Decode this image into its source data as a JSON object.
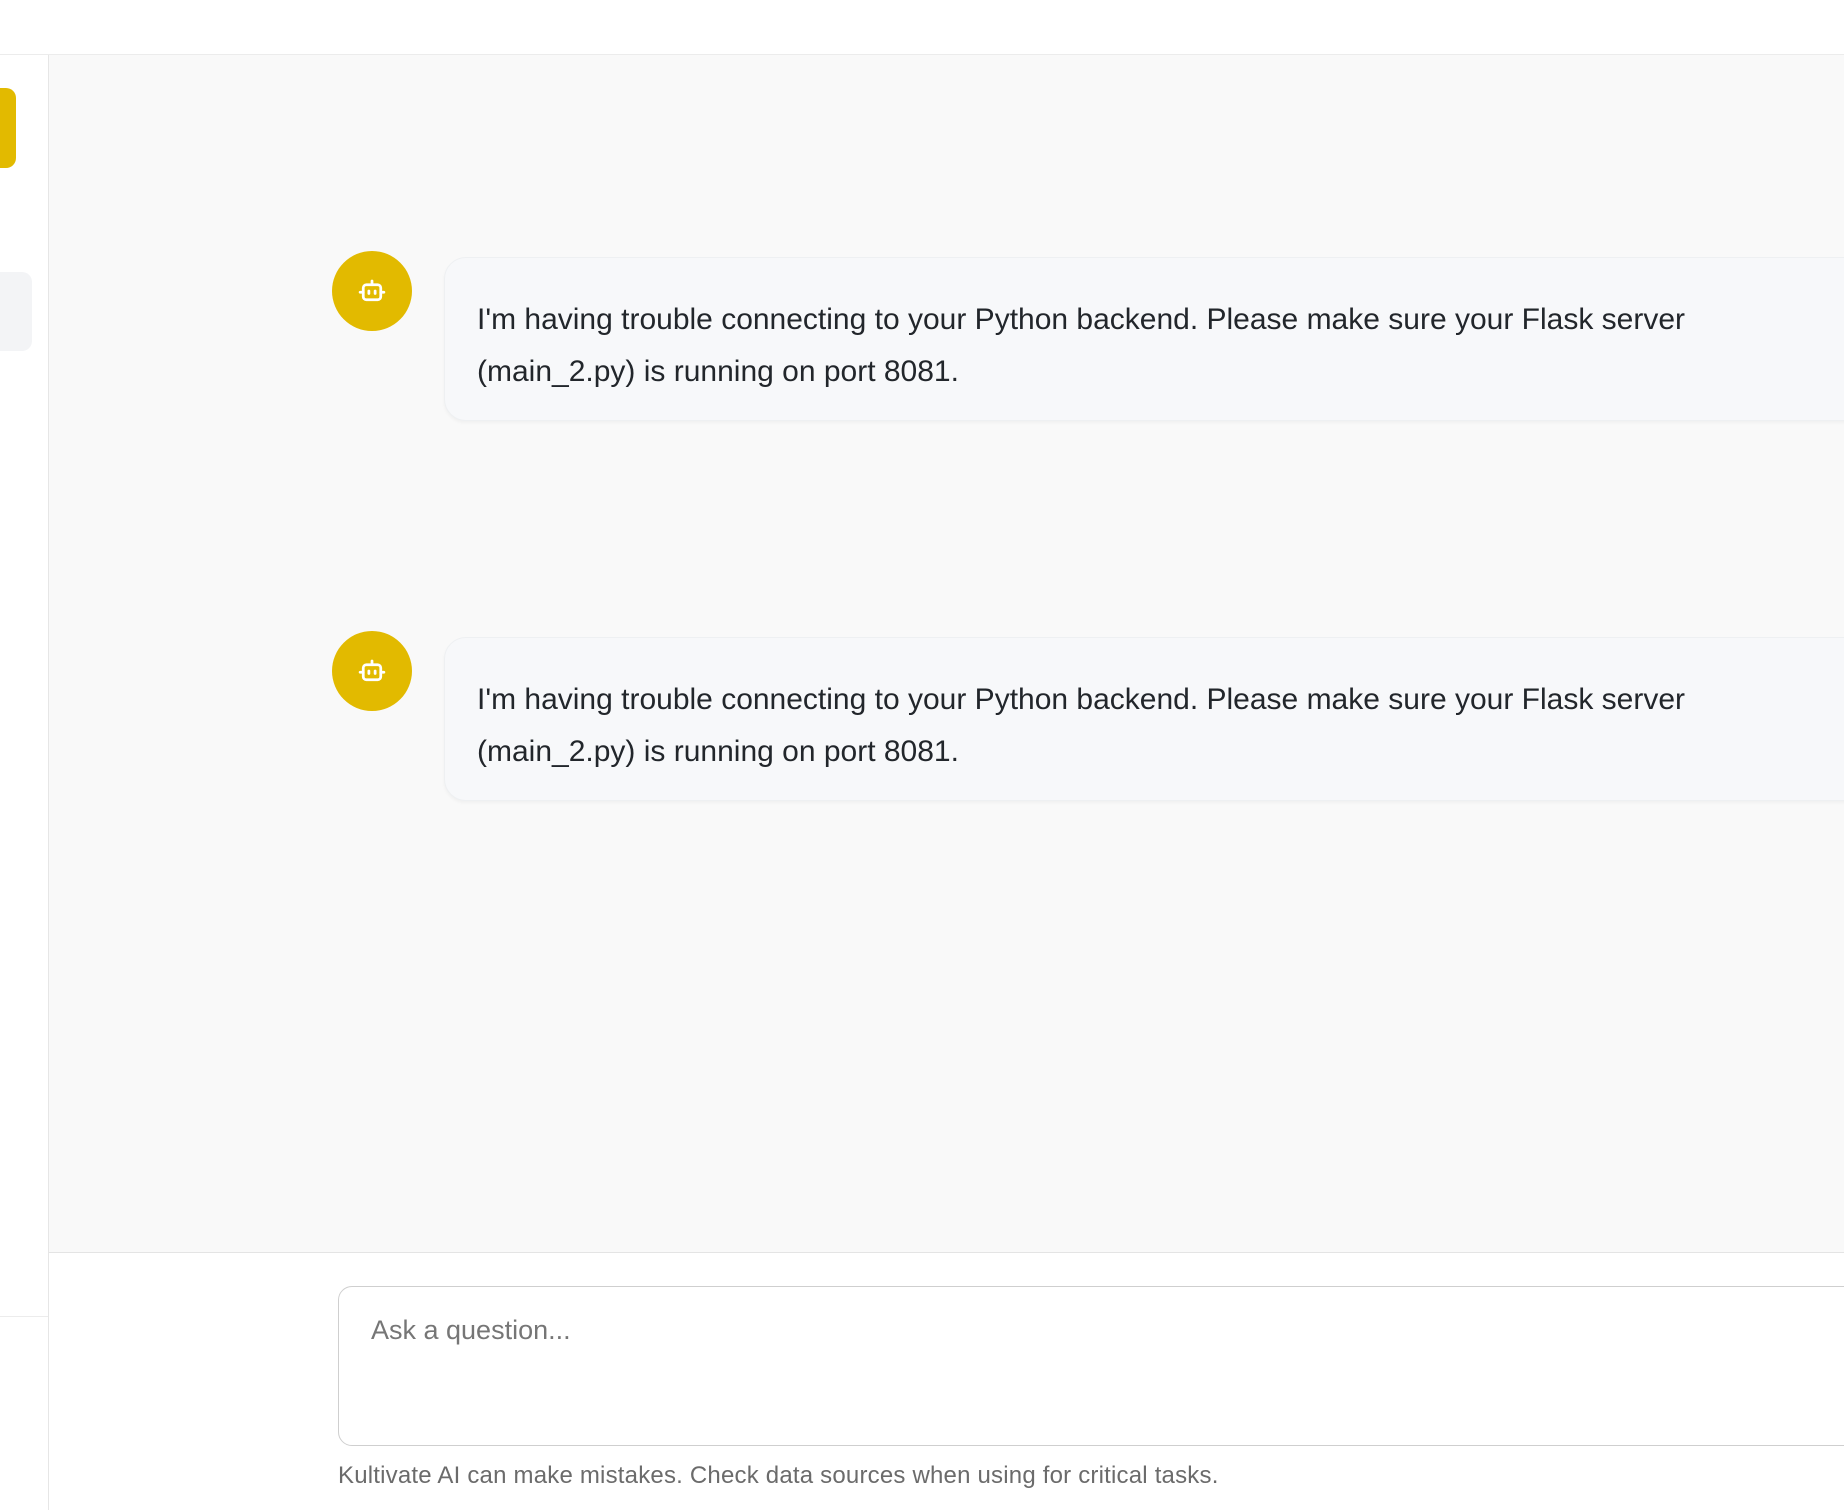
{
  "messages": [
    {
      "role": "assistant",
      "avatar_icon": "robot-icon",
      "text": "I'm having trouble connecting to your Python backend. Please make sure your Flask server (main_2.py) is running on port 8081."
    },
    {
      "role": "assistant",
      "avatar_icon": "robot-icon",
      "text": "I'm having trouble connecting to your Python backend. Please make sure your Flask server (main_2.py) is running on port 8081."
    }
  ],
  "composer": {
    "placeholder": "Ask a question...",
    "value": "",
    "disclaimer": "Kultivate AI can make mistakes. Check data sources when using for critical tasks."
  },
  "colors": {
    "accent": "#e2ba00",
    "chat_bg": "#f9f9f9",
    "bubble_bg": "#f7f8fa"
  }
}
